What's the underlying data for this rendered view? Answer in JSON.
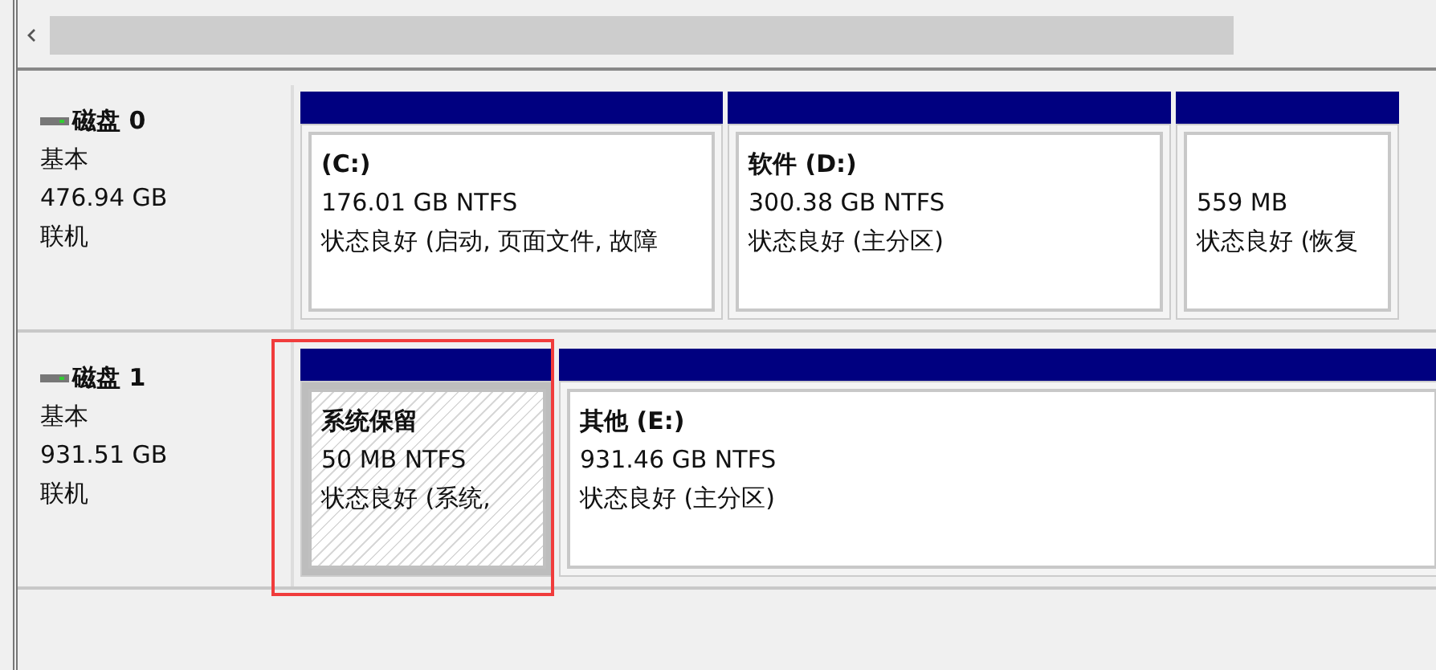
{
  "disks": [
    {
      "name": "磁盘 0",
      "type": "基本",
      "size": "476.94 GB",
      "status": "联机",
      "partitions": [
        {
          "label": "(C:)",
          "size": "176.01 GB NTFS",
          "status": "状态良好 (启动, 页面文件, 故障",
          "selected": false,
          "highlighted": false
        },
        {
          "label": "软件  (D:)",
          "size": "300.38 GB NTFS",
          "status": "状态良好 (主分区)",
          "selected": false,
          "highlighted": false
        },
        {
          "size": "559 MB",
          "status": "状态良好 (恢复",
          "selected": false,
          "highlighted": false
        }
      ]
    },
    {
      "name": "磁盘 1",
      "type": "基本",
      "size": "931.51 GB",
      "status": "联机",
      "partitions": [
        {
          "label": "系统保留",
          "size": "50 MB NTFS",
          "status": "状态良好 (系统,",
          "selected": true,
          "highlighted": true
        },
        {
          "label": "其他  (E:)",
          "size": "931.46 GB NTFS",
          "status": "状态良好 (主分区)",
          "selected": false,
          "highlighted": false
        }
      ]
    }
  ]
}
